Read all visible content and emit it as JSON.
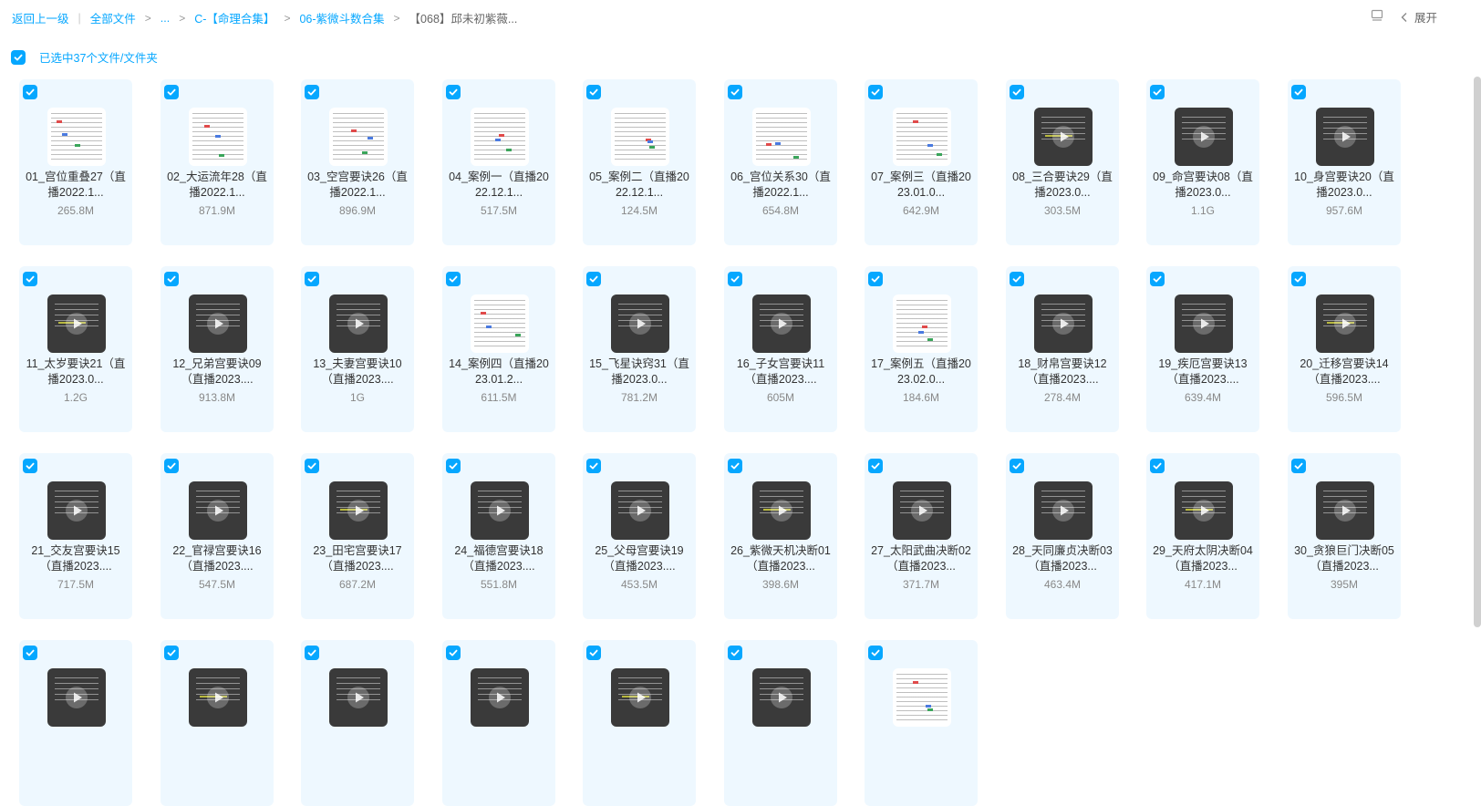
{
  "breadcrumb": {
    "back": "返回上一级",
    "all_files": "全部文件",
    "ellipsis": "...",
    "folder1": "C-【命理合集】",
    "folder2": "06-紫微斗数合集",
    "current": "【068】邱未初紫薇..."
  },
  "top_right": {
    "list_icon": "list-view-icon",
    "expand_label": "展开"
  },
  "selection": {
    "text": "已选中37个文件/文件夹",
    "checked": true
  },
  "accent_color": "#06a7ff",
  "files": [
    {
      "name": "01_宫位重叠27（直播2022.1...",
      "size": "265.8M",
      "type": "doc"
    },
    {
      "name": "02_大运流年28（直播2022.1...",
      "size": "871.9M",
      "type": "doc"
    },
    {
      "name": "03_空宫要诀26（直播2022.1...",
      "size": "896.9M",
      "type": "doc"
    },
    {
      "name": "04_案例一（直播2022.12.1...",
      "size": "517.5M",
      "type": "doc"
    },
    {
      "name": "05_案例二（直播2022.12.1...",
      "size": "124.5M",
      "type": "doc"
    },
    {
      "name": "06_宫位关系30（直播2022.1...",
      "size": "654.8M",
      "type": "doc"
    },
    {
      "name": "07_案例三（直播2023.01.0...",
      "size": "642.9M",
      "type": "doc"
    },
    {
      "name": "08_三合要诀29（直播2023.0...",
      "size": "303.5M",
      "type": "video"
    },
    {
      "name": "09_命宫要诀08（直播2023.0...",
      "size": "1.1G",
      "type": "video"
    },
    {
      "name": "10_身宫要诀20（直播2023.0...",
      "size": "957.6M",
      "type": "video"
    },
    {
      "name": "11_太岁要诀21（直播2023.0...",
      "size": "1.2G",
      "type": "video"
    },
    {
      "name": "12_兄弟宫要诀09（直播2023....",
      "size": "913.8M",
      "type": "video"
    },
    {
      "name": "13_夫妻宫要诀10（直播2023....",
      "size": "1G",
      "type": "video"
    },
    {
      "name": "14_案例四（直播2023.01.2...",
      "size": "611.5M",
      "type": "doc"
    },
    {
      "name": "15_飞星诀窍31（直播2023.0...",
      "size": "781.2M",
      "type": "video"
    },
    {
      "name": "16_子女宫要诀11（直播2023....",
      "size": "605M",
      "type": "video"
    },
    {
      "name": "17_案例五（直播2023.02.0...",
      "size": "184.6M",
      "type": "doc"
    },
    {
      "name": "18_财帛宫要诀12（直播2023....",
      "size": "278.4M",
      "type": "video"
    },
    {
      "name": "19_疾厄宫要诀13（直播2023....",
      "size": "639.4M",
      "type": "video"
    },
    {
      "name": "20_迁移宫要诀14（直播2023....",
      "size": "596.5M",
      "type": "video"
    },
    {
      "name": "21_交友宫要诀15（直播2023....",
      "size": "717.5M",
      "type": "video"
    },
    {
      "name": "22_官禄宫要诀16（直播2023....",
      "size": "547.5M",
      "type": "video"
    },
    {
      "name": "23_田宅宫要诀17（直播2023....",
      "size": "687.2M",
      "type": "video"
    },
    {
      "name": "24_福德宫要诀18（直播2023....",
      "size": "551.8M",
      "type": "video"
    },
    {
      "name": "25_父母宫要诀19（直播2023....",
      "size": "453.5M",
      "type": "video"
    },
    {
      "name": "26_紫微天机决断01（直播2023...",
      "size": "398.6M",
      "type": "video"
    },
    {
      "name": "27_太阳武曲决断02（直播2023...",
      "size": "371.7M",
      "type": "video"
    },
    {
      "name": "28_天同廉贞决断03（直播2023...",
      "size": "463.4M",
      "type": "video"
    },
    {
      "name": "29_天府太阴决断04（直播2023...",
      "size": "417.1M",
      "type": "video"
    },
    {
      "name": "30_贪狼巨门决断05（直播2023...",
      "size": "395M",
      "type": "video"
    },
    {
      "name": "",
      "size": "",
      "type": "video"
    },
    {
      "name": "",
      "size": "",
      "type": "video"
    },
    {
      "name": "",
      "size": "",
      "type": "video"
    },
    {
      "name": "",
      "size": "",
      "type": "video"
    },
    {
      "name": "",
      "size": "",
      "type": "video"
    },
    {
      "name": "",
      "size": "",
      "type": "video"
    },
    {
      "name": "",
      "size": "",
      "type": "doc"
    }
  ]
}
